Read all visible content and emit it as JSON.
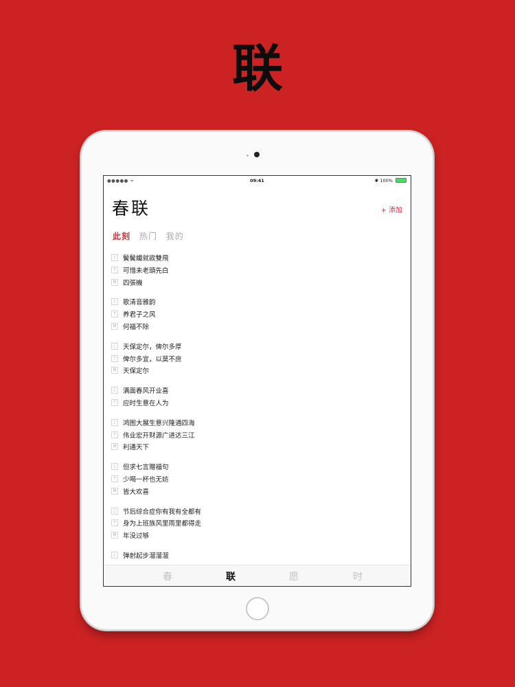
{
  "hero": {
    "char": "联"
  },
  "status_bar": {
    "signal": "●●●●● ≈",
    "time": "09:41",
    "bluetooth": "✱",
    "battery_pct": "100%",
    "battery_level": 1.0
  },
  "header": {
    "title": "春联",
    "add_label": "+ 添加"
  },
  "tabs": [
    {
      "label": "此刻",
      "active": true
    },
    {
      "label": "热门",
      "active": false
    },
    {
      "label": "我的",
      "active": false
    }
  ],
  "couplet_groups": [
    {
      "lines": [
        {
          "mark": "上",
          "text": "鬢鬢纖就欲雙飛"
        },
        {
          "mark": "下",
          "text": "可惜未老頭先白"
        },
        {
          "mark": "横",
          "text": "四張機"
        }
      ]
    },
    {
      "lines": [
        {
          "mark": "上",
          "text": "歌清音雅韵"
        },
        {
          "mark": "下",
          "text": "养君子之风"
        },
        {
          "mark": "横",
          "text": "何福不除"
        }
      ]
    },
    {
      "lines": [
        {
          "mark": "上",
          "text": "天保定尔，俾尔多厚"
        },
        {
          "mark": "下",
          "text": "俾尔多宜，以莫不庶"
        },
        {
          "mark": "横",
          "text": "天保定尔"
        }
      ]
    },
    {
      "lines": [
        {
          "mark": "上",
          "text": "满面春风开业喜"
        },
        {
          "mark": "下",
          "text": "应时生意在人为"
        }
      ]
    },
    {
      "lines": [
        {
          "mark": "上",
          "text": "鸿图大展生意兴隆通四海"
        },
        {
          "mark": "下",
          "text": "伟业宏开财源广进达三江"
        },
        {
          "mark": "横",
          "text": "利通天下"
        }
      ]
    },
    {
      "lines": [
        {
          "mark": "上",
          "text": "但求七言赠福句"
        },
        {
          "mark": "下",
          "text": "少喝一杯也无妨"
        },
        {
          "mark": "横",
          "text": "皆大欢喜"
        }
      ]
    },
    {
      "lines": [
        {
          "mark": "上",
          "text": "节后综合症你有我有全都有"
        },
        {
          "mark": "下",
          "text": "身为上班族风里雨里都得走"
        },
        {
          "mark": "横",
          "text": "年没过够"
        }
      ]
    },
    {
      "lines": [
        {
          "mark": "上",
          "text": "弹射起步溜溜溜"
        }
      ]
    }
  ],
  "tabbar": [
    {
      "label": "春",
      "active": false
    },
    {
      "label": "联",
      "active": true
    },
    {
      "label": "愿",
      "active": false
    },
    {
      "label": "时",
      "active": false
    }
  ]
}
